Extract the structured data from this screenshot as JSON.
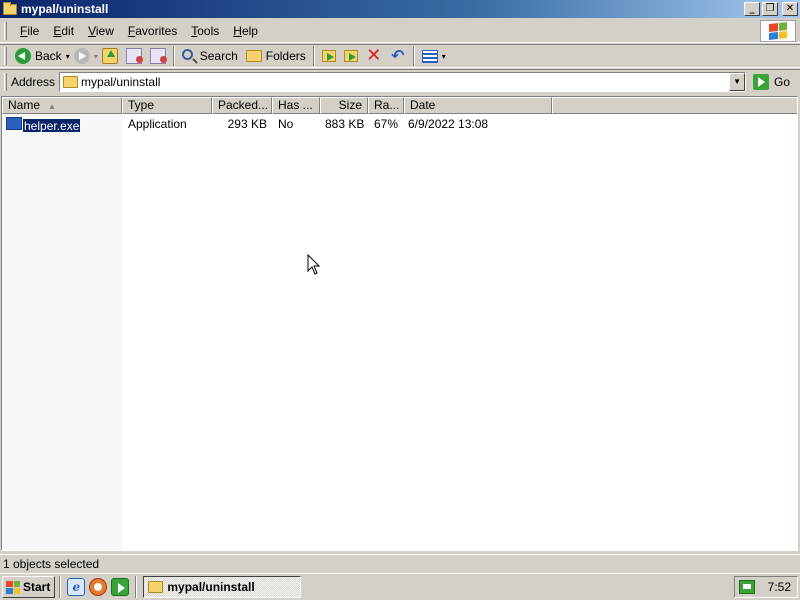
{
  "window": {
    "title": "mypal/uninstall"
  },
  "title_buttons": {
    "minimize": "_",
    "restore": "❐",
    "close": "✕"
  },
  "menu": {
    "items": [
      {
        "key": "F",
        "rest": "ile"
      },
      {
        "key": "E",
        "rest": "dit"
      },
      {
        "key": "V",
        "rest": "iew"
      },
      {
        "key": "F",
        "rest": "avorites",
        "pre": ""
      },
      {
        "key": "T",
        "rest": "ools"
      },
      {
        "key": "H",
        "rest": "elp"
      }
    ]
  },
  "toolbar": {
    "back_label": "Back",
    "search_label": "Search",
    "folders_label": "Folders",
    "caret": "▾",
    "delete_glyph": "✕",
    "undo_glyph": "↶"
  },
  "address": {
    "label": "Address",
    "value": "mypal/uninstall",
    "drop": "▼",
    "go_label": "Go"
  },
  "list": {
    "columns": [
      "Name",
      "Type",
      "Packed...",
      "Has ...",
      "Size",
      "Ra...",
      "Date"
    ],
    "sort_glyph": "▲",
    "rows": [
      {
        "name": "helper.exe",
        "type": "Application",
        "packed": "293 KB",
        "has": "No",
        "size": "883 KB",
        "ratio": "67%",
        "date": "6/9/2022 13:08",
        "selected": true
      }
    ]
  },
  "status": {
    "text": "1 objects selected"
  },
  "taskbar": {
    "start_label": "Start",
    "ie_glyph": "e",
    "task_label": "mypal/uninstall",
    "clock": "7:52"
  },
  "colors": {
    "titlebar_start": "#0a246a",
    "titlebar_end": "#a6caf0",
    "selection": "#0a246a",
    "face": "#d4d0c8"
  },
  "icons": [
    "folder-icon",
    "windows-logo-icon",
    "back-arrow-icon",
    "forward-arrow-icon",
    "up-folder-icon",
    "search-icon",
    "folders-icon",
    "move-to-icon",
    "copy-to-icon",
    "delete-icon",
    "undo-icon",
    "views-icon",
    "go-icon",
    "file-exe-icon",
    "ie-icon",
    "firefox-icon",
    "network-icon",
    "cursor-icon"
  ]
}
